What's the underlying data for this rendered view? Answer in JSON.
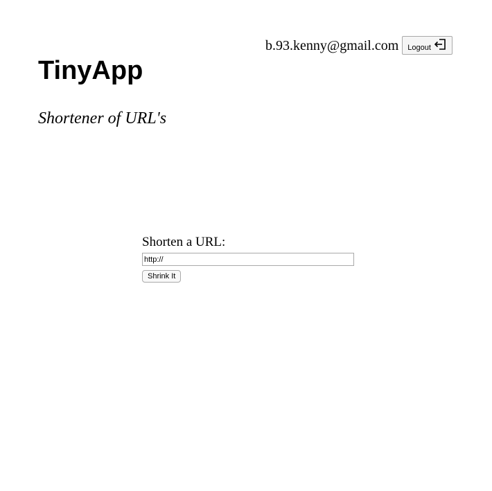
{
  "header": {
    "user_email": "b.93.kenny@gmail.com",
    "logout_label": "Logout",
    "logout_icon": "logout-icon"
  },
  "app": {
    "title": "TinyApp",
    "subtitle": "Shortener of URL's"
  },
  "form": {
    "label": "Shorten a URL:",
    "url_value": "http://",
    "submit_label": "Shrink It"
  }
}
